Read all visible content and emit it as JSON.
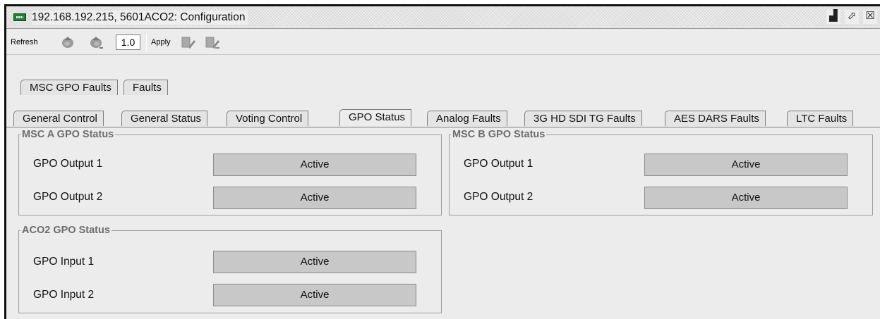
{
  "window": {
    "title": "192.168.192.215, 5601ACO2: Configuration",
    "icon": "device-card-icon",
    "controls": [
      {
        "name": "restore-icon",
        "glyph": "▟"
      },
      {
        "name": "maximize-icon",
        "glyph": "⬀"
      },
      {
        "name": "close-icon",
        "glyph": "☒"
      }
    ]
  },
  "toolbar": {
    "refresh_label": "Refresh",
    "zoom_value": "1.0",
    "apply_label": "Apply"
  },
  "tabs": {
    "top_row": [
      "MSC GPO Faults",
      "Faults"
    ],
    "bottom_row": [
      "General Control",
      "General Status",
      "Voting Control",
      "GPO Status",
      "Analog Faults",
      "3G HD SDI TG Faults",
      "AES DARS Faults",
      "LTC Faults"
    ],
    "selected": "GPO Status"
  },
  "groups": {
    "msc_a": {
      "title": "MSC A GPO Status",
      "rows": [
        {
          "label": "GPO Output 1",
          "value": "Active"
        },
        {
          "label": "GPO Output 2",
          "value": "Active"
        }
      ]
    },
    "msc_b": {
      "title": "MSC B GPO Status",
      "rows": [
        {
          "label": "GPO Output 1",
          "value": "Active"
        },
        {
          "label": "GPO Output 2",
          "value": "Active"
        }
      ]
    },
    "aco2": {
      "title": "ACO2 GPO Status",
      "rows": [
        {
          "label": "GPO Input 1",
          "value": "Active"
        },
        {
          "label": "GPO Input 2",
          "value": "Active"
        }
      ]
    }
  },
  "colors": {
    "window_bg": "#ececec",
    "status_box_bg": "#c8c8c8",
    "group_title": "#6d6d6d",
    "title_icon": "#1e7d35"
  }
}
